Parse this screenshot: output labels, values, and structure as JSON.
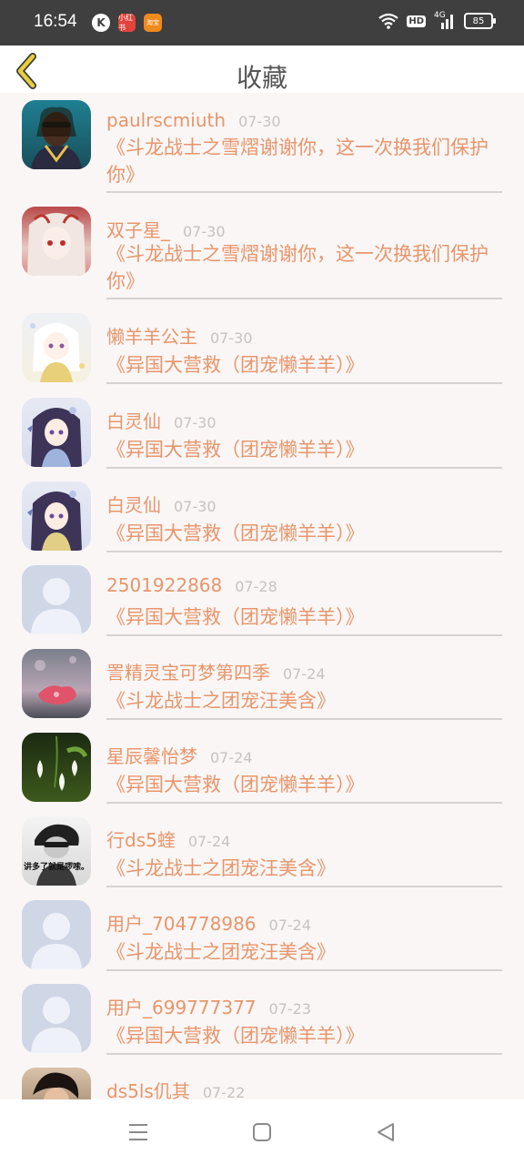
{
  "status": {
    "time": "16:54",
    "app_icons": [
      "K",
      "小红书",
      "淘宝"
    ],
    "network": "4G",
    "hd": "HD",
    "battery": "85"
  },
  "header": {
    "title": "收藏",
    "back_icon": "chevron-left-icon"
  },
  "items": [
    {
      "user": "paulrscmiuth",
      "date": "07-30",
      "title": "《斗龙战士之雪熠谢谢你，这一次换我们保护你》",
      "avatar": "photo-rapper"
    },
    {
      "user": "双子星_",
      "date": "07-30",
      "title": "《斗龙战士之雪熠谢谢你，这一次换我们保护你》",
      "avatar": "anime-red-eyes"
    },
    {
      "user": "懒羊羊公主",
      "date": "07-30",
      "title": "《异国大营救（团宠懒羊羊）》",
      "avatar": "anime-white-hair"
    },
    {
      "user": "白灵仙",
      "date": "07-30",
      "title": "《异国大营救（团宠懒羊羊）》",
      "avatar": "anime-purple-hair"
    },
    {
      "user": "白灵仙",
      "date": "07-30",
      "title": "《异国大营救（团宠懒羊羊）》",
      "avatar": "anime-purple-hair"
    },
    {
      "user": "2501922868",
      "date": "07-28",
      "title": "《异国大营救（团宠懒羊羊）》",
      "avatar": "default-avatar"
    },
    {
      "user": "詈精灵宝可梦第四季",
      "date": "07-24",
      "title": "《斗龙战士之团宠汪美含》",
      "avatar": "photo-flower-pink"
    },
    {
      "user": "星辰馨怡梦",
      "date": "07-24",
      "title": "《异国大营救（团宠懒羊羊）》",
      "avatar": "photo-snowdrop"
    },
    {
      "user": "行ds5蝰",
      "date": "07-24",
      "title": "《斗龙战士之团宠汪美含》",
      "avatar": "photo-bw-caption",
      "avatar_caption": "讲多了就是啰嗦。"
    },
    {
      "user": "用户_704778986",
      "date": "07-24",
      "title": "《斗龙战士之团宠汪美含》",
      "avatar": "default-avatar"
    },
    {
      "user": "用户_699777377",
      "date": "07-23",
      "title": "《异国大营救（团宠懒羊羊）》",
      "avatar": "default-avatar"
    },
    {
      "user": "ds5ls仉其",
      "date": "07-22",
      "title": "",
      "avatar": "photo-dark-hair"
    }
  ],
  "colors": {
    "accent": "#e8956a",
    "date": "#c7c2c2",
    "status_bar": "#3f3f3f",
    "background": "#faf6f6",
    "back_icon": "#e6cf3a"
  },
  "nav": {
    "menu_icon": "menu-icon",
    "home_icon": "home-icon",
    "back_icon": "back-triangle-icon"
  }
}
